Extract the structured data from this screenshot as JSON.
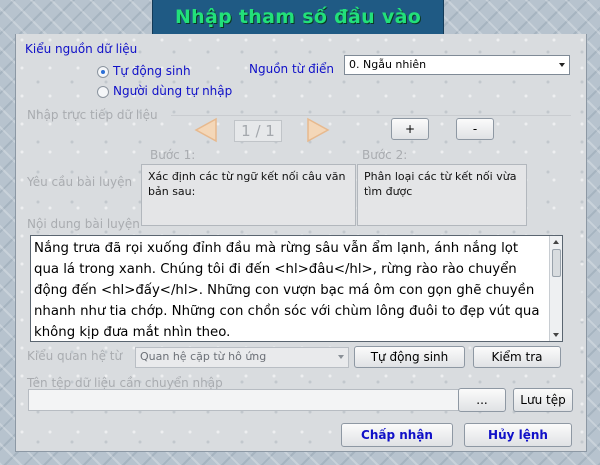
{
  "window": {
    "title": "Nhập tham số đầu vào"
  },
  "source_type": {
    "label": "Kiểu nguồn dữ liệu",
    "options": [
      {
        "label": "Tự động sinh",
        "selected": true
      },
      {
        "label": "Người dùng tự nhập",
        "selected": false
      }
    ]
  },
  "dictionary_source": {
    "label": "Nguồn từ điển",
    "value": "0. Ngẫu nhiên"
  },
  "direct_input": {
    "label": "Nhập trực tiếp dữ liệu",
    "page_indicator": "1 / 1",
    "add_label": "+",
    "remove_label": "-"
  },
  "requirement": {
    "label": "Yêu cầu bài luyện",
    "step1_label": "Bước 1:",
    "step1_text": "Xác định các từ ngữ kết nối câu văn bản sau:",
    "step2_label": "Bước 2:",
    "step2_text": "Phân loại các từ kết nối vừa tìm được"
  },
  "content": {
    "label": "Nội dung bài luyện",
    "text": "Nắng trưa đã rọi xuống đỉnh đầu mà rừng sâu vẫn ẩm lạnh, ánh nắng lọt qua lá trong xanh. Chúng tôi đi đến <hl>đâu</hl>, rừng rào rào chuyển động đến <hl>đấy</hl>. Những con vượn bạc má ôm con gọn ghẽ chuyền nhanh như tia chớp. Những con chồn sóc với chùm lông đuôi to đẹp vút qua không kịp đưa mắt nhìn theo."
  },
  "relation": {
    "label": "Kiểu quan hệ từ",
    "value": "Quan hệ cặp từ hô ứng",
    "auto_button": "Tự động sinh",
    "check_button": "Kiểm tra"
  },
  "file": {
    "label": "Tên tệp dữ liệu cần chuyển nhập",
    "value": "",
    "browse_button": "...",
    "save_button": "Lưu tệp"
  },
  "actions": {
    "accept": "Chấp nhận",
    "cancel": "Hủy lệnh"
  },
  "colors": {
    "title_bg": "#1f5a84",
    "title_text": "#22e07a",
    "label_blue": "#1010c8",
    "disabled_grey": "#a9acb0"
  }
}
